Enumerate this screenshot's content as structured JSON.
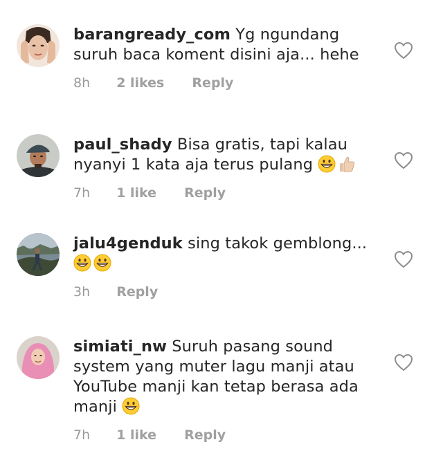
{
  "colors": {
    "text": "#262626",
    "meta": "#9a9a9a",
    "heart_outline": "#8e8e8e",
    "background": "#ffffff"
  },
  "comments": [
    {
      "username": "barangready_com",
      "text": "Yg ngundang suruh baca koment disini aja... hehe",
      "time": "8h",
      "likes": "2 likes",
      "reply": "Reply",
      "emojis": [],
      "avatar_icon": "woman-hands-face-avatar"
    },
    {
      "username": "paul_shady",
      "text": "Bisa gratis, tapi kalau nyanyi 1 kata aja terus pulang",
      "time": "7h",
      "likes": "1 like",
      "reply": "Reply",
      "emojis": [
        "grinning-face-emoji",
        "thumbs-up-emoji"
      ],
      "avatar_icon": "man-cap-avatar"
    },
    {
      "username": "jalu4genduk",
      "text": "sing takok gemblong...",
      "time": "3h",
      "likes": "",
      "reply": "Reply",
      "emojis": [
        "grinning-face-emoji",
        "grinning-face-emoji"
      ],
      "avatar_icon": "outdoor-person-avatar"
    },
    {
      "username": "simiati_nw",
      "text": "Suruh pasang sound system yang muter lagu manji atau YouTube manji kan tetap berasa ada manji",
      "time": "7h",
      "likes": "1 like",
      "reply": "Reply",
      "emojis": [
        "grinning-face-emoji"
      ],
      "avatar_icon": "woman-pink-hijab-avatar"
    }
  ]
}
